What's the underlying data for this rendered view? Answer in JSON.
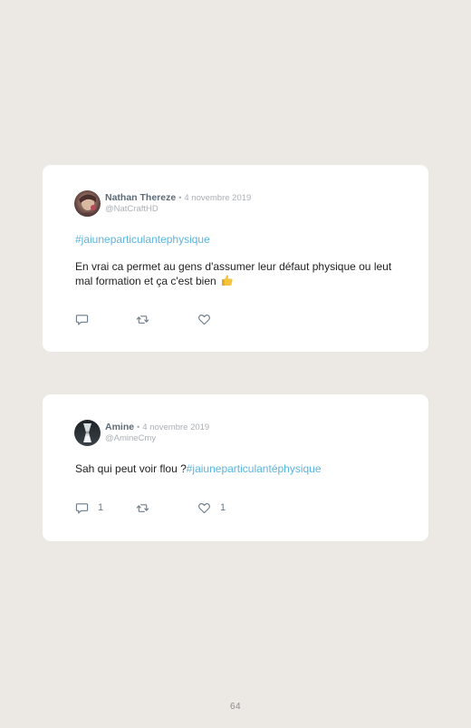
{
  "tweets": [
    {
      "author_name": "Nathan Thereze",
      "separator": "•",
      "date": "4 novembre 2019",
      "handle": "@NatCraftHD",
      "hashtag": "#jaiuneparticulantephysique",
      "text": "En vrai ca permet au gens d'assumer leur défaut physique ou leut mal formation et ça c'est bien",
      "emoji": "👍",
      "reply_count": "",
      "retweet_count": "",
      "like_count": ""
    },
    {
      "author_name": "Amine",
      "separator": "•",
      "date": "4 novembre 2019",
      "handle": "@AmineCmy",
      "text": "Sah qui peut voir flou ?",
      "hashtag": "#jaiuneparticulantéphysique",
      "reply_count": "1",
      "retweet_count": "",
      "like_count": "1"
    }
  ],
  "icons": {
    "reply": "comment-bubble-icon",
    "retweet": "retweet-arrows-icon",
    "like": "heart-outline-icon"
  },
  "colors": {
    "background": "#ece9e4",
    "card": "#ffffff",
    "hashtag": "#5ab4e0",
    "name": "#5d6b76",
    "muted": "#a9b0b6",
    "icon": "#6b7b88"
  },
  "page_number": "64"
}
